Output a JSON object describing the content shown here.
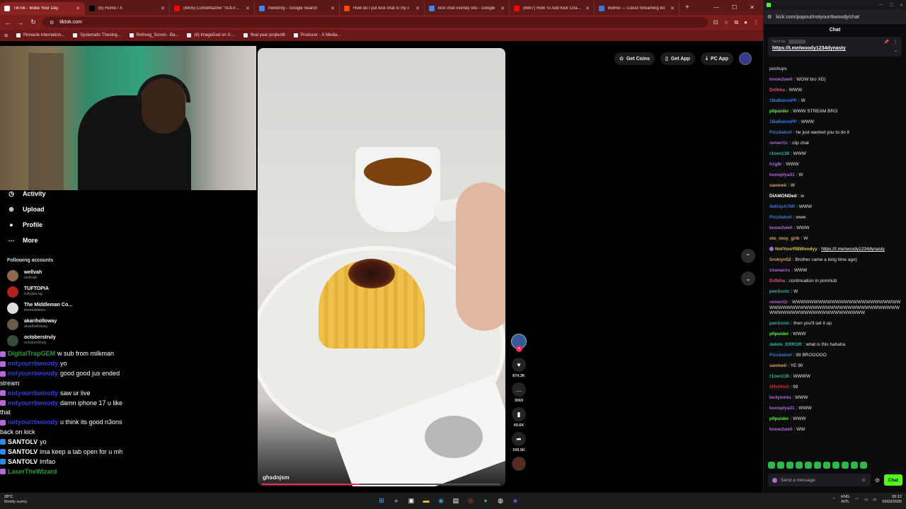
{
  "browser": {
    "tabs": [
      {
        "label": "TikTok - Make Your Day",
        "active": true,
        "color": "#ffffff"
      },
      {
        "label": "(6) Home / X",
        "active": false,
        "color": "#000000"
      },
      {
        "label": "(8805) Comethazine \"SOLVED\"",
        "active": false,
        "color": "#ff0000"
      },
      {
        "label": "mellstroy - Google Search",
        "active": false,
        "color": "#4285f4"
      },
      {
        "label": "How do I put kick chat in my c",
        "active": false,
        "color": "#ff4500"
      },
      {
        "label": "kick chat overlay obs - Google",
        "active": false,
        "color": "#4285f4"
      },
      {
        "label": "(8807) How To Add Kick Chat C",
        "active": false,
        "color": "#ff0000"
      },
      {
        "label": "BotRix — Cloud Streaming Bo",
        "active": false,
        "color": "#3a7bd5"
      }
    ],
    "new_tab": "+",
    "url": "tiktok.com",
    "bookmarks": [
      "Pinnacle Internation...",
      "Systematic Theolog...",
      "Refreeg_Scrum - Ba...",
      "(4) ImageGod on X:...",
      "final year projlect6",
      "Producer - X Media..."
    ]
  },
  "tiktok": {
    "top_buttons": {
      "coins": "Get Coins",
      "app": "Get App",
      "pc": "PC App"
    },
    "nav": [
      {
        "label": "Activity",
        "icon": "activity-icon"
      },
      {
        "label": "Upload",
        "icon": "upload-icon"
      },
      {
        "label": "Profile",
        "icon": "profile-icon"
      },
      {
        "label": "More",
        "icon": "more-icon"
      }
    ],
    "following_title": "Following accounts",
    "following": [
      {
        "name": "wellvah",
        "handle": "wellvah",
        "color": "#8a6a4a"
      },
      {
        "name": "TUFTOPIA",
        "handle": "tuftopia.ng",
        "color": "#b02020"
      },
      {
        "name": "The Middleman Co...",
        "handle": "themiddleinc",
        "color": "#dddddd"
      },
      {
        "name": "akariholloway",
        "handle": "akariholloway",
        "color": "#6a5a4a"
      },
      {
        "name": "octoberstruly",
        "handle": "octoberstruly",
        "color": "#3a4a3a"
      }
    ],
    "video": {
      "caption": "ghsdnjsm",
      "progress": 0.41
    },
    "actions": {
      "likes": "874.3K",
      "comments": "3069",
      "saves": "49.6K",
      "shares": "100.5K"
    },
    "overlay_chat": [
      {
        "user": "DigitalTrapGEM",
        "text": "w sub from milkman",
        "badge": "purple",
        "ucolor": "green"
      },
      {
        "user": "notyourrbwoody",
        "text": "yo",
        "badge": "purple",
        "ucolor": "blue"
      },
      {
        "user": "notyourrbwoody",
        "text": "good good jus ended stream",
        "badge": "purple",
        "ucolor": "blue"
      },
      {
        "user": "notyourrbwoody",
        "text": "saw ur live",
        "badge": "purple",
        "ucolor": "blue"
      },
      {
        "user": "notyourrbwoody",
        "text": "damn iphone 17 u like that",
        "badge": "purple",
        "ucolor": "blue"
      },
      {
        "user": "notyourrbwoody",
        "text": "u think its good n3ons back on kick",
        "badge": "purple",
        "ucolor": "blue"
      },
      {
        "user": "SANTOLV",
        "text": "yo",
        "badge": "blue",
        "ucolor": "white"
      },
      {
        "user": "SANTOLV",
        "text": "ima keep a tab open for u mh",
        "badge": "blue",
        "ucolor": "white"
      },
      {
        "user": "SANTOLV",
        "text": "lmfao",
        "badge": "blue",
        "ucolor": "white"
      },
      {
        "user": "LaserTheWizard",
        "text": "",
        "badge": "purple",
        "ucolor": "green"
      }
    ]
  },
  "chat": {
    "window_url": "kick.com/popout/notyourrbwoody/chat",
    "header": "Chat",
    "pinned_label": "Sent by",
    "pinned_link": "https://t.me/woody1234dynasty",
    "messages": [
      {
        "user": "",
        "color": "#ffffff",
        "text": "pushups"
      },
      {
        "user": "know2well",
        "color": "#b36ad6",
        "text": "WOW bro XD)"
      },
      {
        "user": "Dr0kha",
        "color": "#e0507a",
        "text": "WWW"
      },
      {
        "user": "1BaBatonPP",
        "color": "#3a7bd5",
        "text": "W"
      },
      {
        "user": "p0puider",
        "color": "#53fc18",
        "text": "WWW STREAM BRO"
      },
      {
        "user": "1BaBatonPP",
        "color": "#3a7bd5",
        "text": "WWW"
      },
      {
        "user": "Pizzdaboll",
        "color": "#3a7bd5",
        "text": "he just wanted you to do it"
      },
      {
        "user": "remert1r",
        "color": "#b36ad6",
        "text": "clip chat"
      },
      {
        "user": "r1zen139",
        "color": "#2fb8a0",
        "text": "WWW"
      },
      {
        "user": "h1g8r",
        "color": "#b36ad6",
        "text": "WWW"
      },
      {
        "user": "konoplya31",
        "color": "#b36ad6",
        "text": "W"
      },
      {
        "user": "sanmeii",
        "color": "#e0a060",
        "text": "W"
      },
      {
        "user": "DIAMONDed",
        "color": "#ffffff",
        "text": "w"
      },
      {
        "user": "4e6UpA70R",
        "color": "#3a7bd5",
        "text": "WWW"
      },
      {
        "user": "Pizzdaboll",
        "color": "#3a7bd5",
        "text": "www"
      },
      {
        "user": "know2well",
        "color": "#b36ad6",
        "text": "WWW"
      },
      {
        "user": "eto_moy_grib",
        "color": "#e0a060",
        "text": "W"
      },
      {
        "user": "NotYourRBWoodyy",
        "color": "#e0c050",
        "text": "",
        "link": "https://t.me/woody1234dynasty"
      },
      {
        "user": "brokiyn52",
        "color": "#e0a060",
        "text": "Brother came a long time ago)"
      },
      {
        "user": "xxanaxxs",
        "color": "#b36ad6",
        "text": "WWW"
      },
      {
        "user": "Dr0kha",
        "color": "#e0507a",
        "text": "continuation in pornhub"
      },
      {
        "user": "pen1onic",
        "color": "#2fb8a0",
        "text": "W"
      },
      {
        "user": "remert1r",
        "color": "#b36ad6",
        "text": "WWWWWWWWWWWWWWWWWWWWWWWWWWWWWWWWWWWWWWWWWWWWWWWWWWWWWWWWWWWWWWWWWWWWWWWWWWWWW"
      },
      {
        "user": "pen1onic",
        "color": "#2fb8a0",
        "text": "then you'll set it up"
      },
      {
        "user": "p0puider",
        "color": "#53fc18",
        "text": "WWW"
      },
      {
        "user": "delete_ERROR",
        "color": "#2fb8a0",
        "text": "what is this hahaha"
      },
      {
        "user": "Pizzdaboll",
        "color": "#3a7bd5",
        "text": "99 BROOOOO"
      },
      {
        "user": "sanmeii",
        "color": "#e0a060",
        "text": "YE 90"
      },
      {
        "user": "r1zen139",
        "color": "#2fb8a0",
        "text": "WWWW"
      },
      {
        "user": "0Hx0Hx0",
        "color": "#e0203a",
        "text": "99"
      },
      {
        "user": "be3ymniu",
        "color": "#b36ad6",
        "text": "WWW"
      },
      {
        "user": "konoplya31",
        "color": "#b36ad6",
        "text": "WWW"
      },
      {
        "user": "p0puider",
        "color": "#53fc18",
        "text": "WWW"
      },
      {
        "user": "know2well",
        "color": "#b36ad6",
        "text": "WW"
      }
    ],
    "emote_count": 11,
    "input_placeholder": "Send a message",
    "send_label": "Chat"
  },
  "taskbar": {
    "weather_temp": "28°C",
    "weather_desc": "Mostly sunny",
    "lang_top": "ENG",
    "lang_bottom": "INTL",
    "time": "00:12",
    "date": "02/03/2026"
  }
}
